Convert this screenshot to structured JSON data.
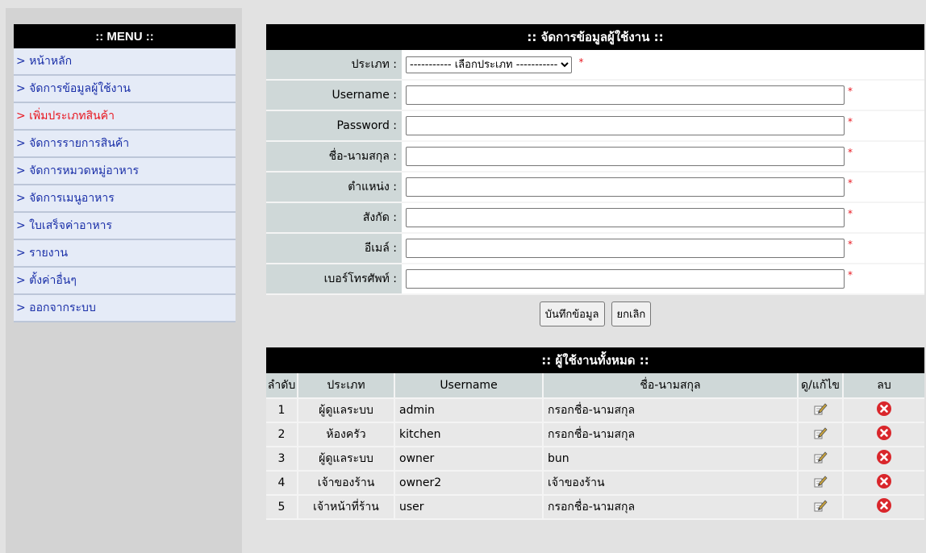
{
  "menu": {
    "title": ":: MENU ::",
    "items": [
      "> หน้าหลัก",
      "> จัดการข้อมูลผู้ใช้งาน",
      "> เพิ่มประเภทสินค้า",
      "> จัดการรายการสินค้า",
      "> จัดการหมวดหมู่อาหาร",
      "> จัดการเมนูอาหาร",
      "> ใบเสร็จค่าอาหาร",
      "> รายงาน",
      "> ตั้งค่าอื่นๆ",
      "> ออกจากระบบ"
    ],
    "active_index": 2
  },
  "form": {
    "title": ":: จัดการข้อมูลผู้ใช้งาน ::",
    "type_label": "ประเภท :",
    "type_selected": "----------- เลือกประเภท -----------",
    "username_label": "Username :",
    "password_label": "Password :",
    "fullname_label": "ชื่อ-นามสกุล :",
    "position_label": "ตำแหน่ง :",
    "affiliation_label": "สังกัด :",
    "email_label": "อีเมล์ :",
    "phone_label": "เบอร์โทรศัพท์ :",
    "required_mark": "*",
    "save_button": "บันทึกข้อมูล",
    "cancel_button": "ยกเลิก"
  },
  "users": {
    "title": ":: ผู้ใช้งานทั้งหมด ::",
    "headers": {
      "no": "ลำดับ",
      "type": "ประเภท",
      "username": "Username",
      "fullname": "ชื่อ-นามสกุล",
      "edit": "ดู/แก้ไข",
      "delete": "ลบ"
    },
    "rows": [
      {
        "no": "1",
        "type": "ผู้ดูแลระบบ",
        "username": "admin",
        "fullname": "กรอกชื่อ-นามสกุล"
      },
      {
        "no": "2",
        "type": "ห้องครัว",
        "username": "kitchen",
        "fullname": "กรอกชื่อ-นามสกุล"
      },
      {
        "no": "3",
        "type": "ผู้ดูแลระบบ",
        "username": "owner",
        "fullname": "bun"
      },
      {
        "no": "4",
        "type": "เจ้าของร้าน",
        "username": "owner2",
        "fullname": "เจ้าของร้าน"
      },
      {
        "no": "5",
        "type": "เจ้าหน้าที่ร้าน",
        "username": "user",
        "fullname": "กรอกชื่อ-นามสกุล"
      }
    ],
    "edit_icon": "edit-pencil-icon",
    "delete_icon": "delete-x-icon"
  },
  "colors": {
    "required": "#e8161f",
    "menu_link": "#1a2fa8",
    "delete_icon": "#d9262b"
  }
}
